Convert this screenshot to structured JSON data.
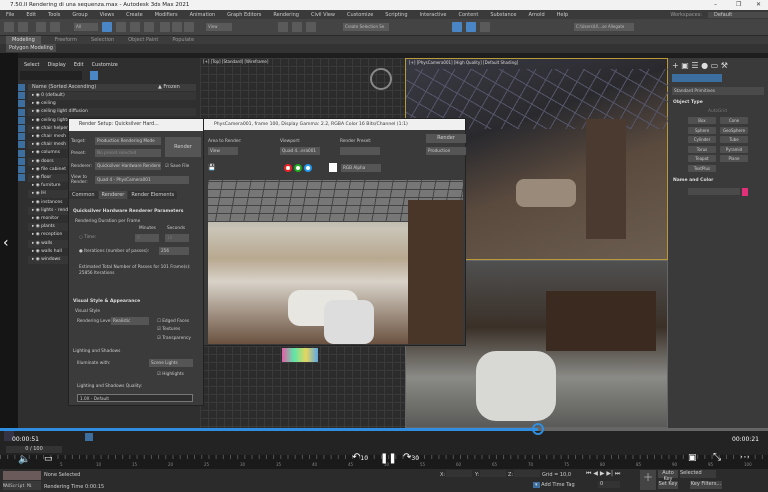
{
  "window": {
    "title": "7.50.II Rendering di una sequenza.max - Autodesk 3ds Max 2021",
    "minimize": "–",
    "restore": "❐",
    "close": "✕"
  },
  "menu": [
    "File",
    "Edit",
    "Tools",
    "Group",
    "Views",
    "Create",
    "Modifiers",
    "Animation",
    "Graph Editors",
    "Rendering",
    "Civil View",
    "Customize",
    "Scripting",
    "Interactive",
    "Content",
    "Substance",
    "Arnold",
    "Help"
  ],
  "workspace": {
    "label": "Workspaces:",
    "value": "Default"
  },
  "toolbar": {
    "filter": "All",
    "view": "View",
    "selection_set": "Create Selection Se",
    "path": "C:\\Users\\U\\...se Allegate"
  },
  "ribbon": {
    "tabs": [
      "Modeling",
      "Freeform",
      "Selection",
      "Object Paint",
      "Populate"
    ],
    "active": "Modeling",
    "sub": "Polygon Modeling"
  },
  "explorer": {
    "menu": [
      "Select",
      "Display",
      "Edit",
      "Customize"
    ],
    "col_name": "Name (Sorted Ascending)",
    "col_frozen": "▲ Frozen",
    "rows": [
      "0 (default)",
      "ceiling",
      "ceiling light diffusion",
      "ceiling lights",
      "chair helper",
      "chair mesh",
      "chair mesh",
      "columns",
      "doors",
      "file cabinet",
      "floor",
      "furniture",
      "IH",
      "instances",
      "lights - render",
      "monitor",
      "plants",
      "reception",
      "walls",
      "walls hall",
      "windows"
    ],
    "name": "Scene Explorer 1"
  },
  "viewports": {
    "top": "[+] [Top] [Standard] [Wireframe]",
    "camera": "[+] [PhysCamera001] [High Quality] [Default Shading]",
    "bottom": "[Default Shading]"
  },
  "render_setup": {
    "title": "Render Setup: Quicksilver Hard...",
    "target_label": "Target:",
    "target": "Production Rendering Mode",
    "preset_label": "Preset:",
    "preset": "No preset selected",
    "renderer_label": "Renderer:",
    "renderer": "Quicksilver Hardware Rendere",
    "save_file": "Save File",
    "view_label": "View to Render:",
    "view": "Quad 4 - PhysCamera001",
    "render_btn": "Render",
    "tabs": [
      "Common",
      "Renderer",
      "Render Elements"
    ],
    "qs_title": "Quicksilver Hardware Renderer Parameters",
    "duration": "Rendering Duration per Frame",
    "minutes": "Minutes",
    "seconds": "Seconds",
    "time": "Time:",
    "time_min": "0",
    "time_sec": "10",
    "iterations": "Iterations (number of passes):",
    "iterations_val": "256",
    "estimate": "Estimated Total Number of Passes for 101 Frame(s):",
    "estimate_val": "25856 Iterations",
    "vs_title": "Visual Style & Appearance",
    "visual_style": "Visual Style",
    "level_label": "Rendering Level",
    "level": "Realistic",
    "edged": "Edged Faces",
    "textures": "Textures",
    "transparency": "Transparency",
    "lighting": "Lighting and Shadows",
    "illum_label": "Illuminate with:",
    "illum": "Scene Lights",
    "highlights": "Highlights",
    "quality_label": "Lighting and Shadows Quality:",
    "quality": "1.0X - Default"
  },
  "frame_window": {
    "title": "PhysCamera001, frame 100, Display Gamma: 2.2, RGBA Color 16 Bits/Channel (1:1)",
    "area_label": "Area to Render:",
    "area": "View",
    "viewport_label": "Viewport:",
    "viewport": "Quad 4...era001",
    "preset_label": "Render Preset:",
    "render_btn": "Render",
    "mode": "Production",
    "channel": "RGB Alpha"
  },
  "command_panel": {
    "dropdown": "Standard Primitives",
    "object_type": "Object Type",
    "autogrid": "AutoGrid",
    "buttons": [
      "Box",
      "Cone",
      "Sphere",
      "GeoSphere",
      "Cylinder",
      "Tube",
      "Torus",
      "Pyramid",
      "Teapot",
      "Plane",
      "TextPlus"
    ],
    "name_color": "Name and Color",
    "color": "#e0307a"
  },
  "timeline": {
    "frame": "0 / 100",
    "ticks": [
      "5",
      "10",
      "15",
      "20",
      "25",
      "30",
      "35",
      "40",
      "45",
      "50",
      "55",
      "60",
      "65",
      "70",
      "75",
      "80",
      "85",
      "90",
      "95",
      "100"
    ]
  },
  "status": {
    "selected": "None Selected",
    "render_time": "Rendering Time 0:00:15",
    "maxscript": "MAXScript Mi",
    "x": "X:",
    "y": "Y:",
    "z": "Z:",
    "grid": "Grid = 10,0",
    "add_time_tag": "Add Time Tag",
    "auto_key": "Auto Key",
    "set_key": "Set Key",
    "selected_dd": "Selected",
    "key_filters": "Key Filters...",
    "frame_field": "0"
  },
  "video": {
    "elapsed": "00:00:51",
    "remaining": "00:00:21",
    "progress": 0.7,
    "rewind": "10",
    "forward": "30",
    "accent": "#2f8ee0"
  }
}
